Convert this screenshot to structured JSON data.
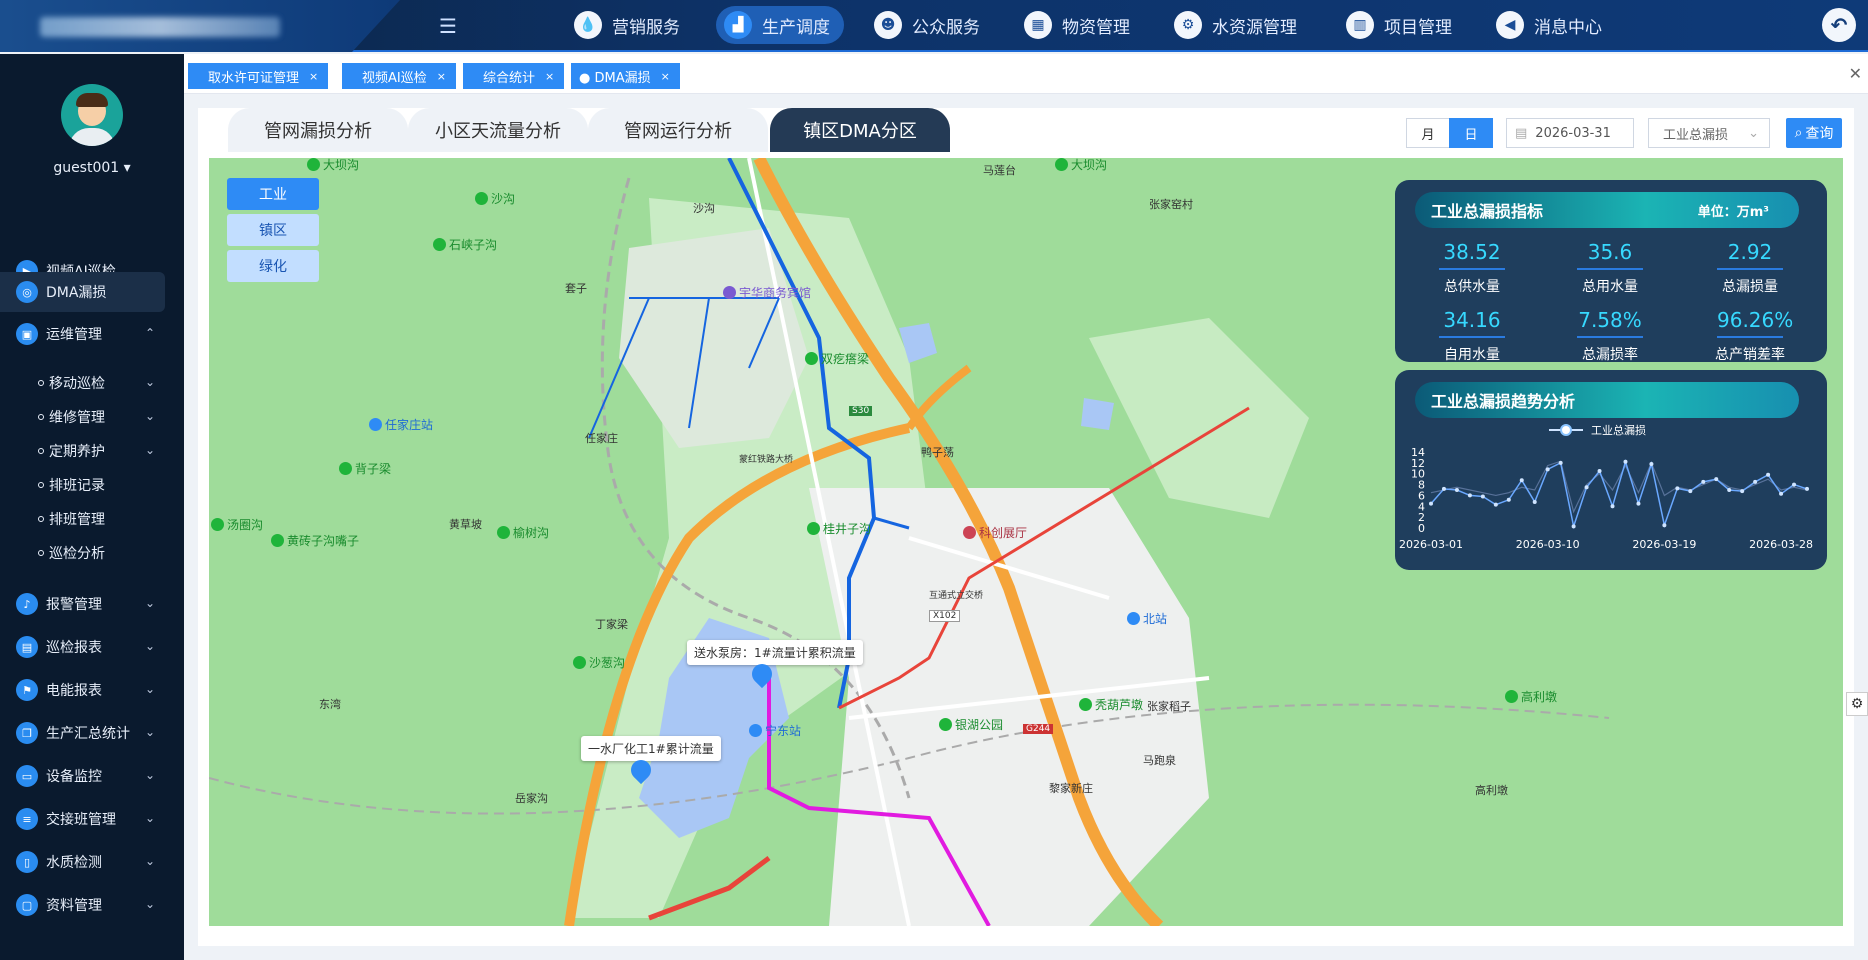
{
  "header": {
    "menu_icon": "menu-fold-icon",
    "nav": [
      {
        "label": "营销服务",
        "icon": "water-drop-icon",
        "active": false
      },
      {
        "label": "生产调度",
        "icon": "chart-icon",
        "active": true
      },
      {
        "label": "公众服务",
        "icon": "user-icon",
        "active": false
      },
      {
        "label": "物资管理",
        "icon": "boxes-icon",
        "active": false
      },
      {
        "label": "水资源管理",
        "icon": "water-settings-icon",
        "active": false
      },
      {
        "label": "项目管理",
        "icon": "building-icon",
        "active": false
      },
      {
        "label": "消息中心",
        "icon": "speaker-icon",
        "active": false
      }
    ]
  },
  "user": {
    "name": "guest001"
  },
  "sidebar": {
    "items": [
      {
        "label": "视频AI巡检"
      },
      {
        "label": "DMA漏损"
      },
      {
        "label": "运维管理"
      },
      {
        "label": "报警管理"
      },
      {
        "label": "巡检报表"
      },
      {
        "label": "电能报表"
      },
      {
        "label": "生产汇总统计"
      },
      {
        "label": "设备监控"
      },
      {
        "label": "交接班管理"
      },
      {
        "label": "水质检测"
      },
      {
        "label": "资料管理"
      }
    ],
    "subitems": [
      {
        "label": "移动巡检"
      },
      {
        "label": "维修管理"
      },
      {
        "label": "定期养护"
      },
      {
        "label": "排班记录"
      },
      {
        "label": "排班管理"
      },
      {
        "label": "巡检分析"
      }
    ]
  },
  "tabs": [
    {
      "label": "取水许可证管理"
    },
    {
      "label": "视频AI巡检"
    },
    {
      "label": "综合统计"
    },
    {
      "label": "● DMA漏损"
    }
  ],
  "subtabs": [
    {
      "label": "管网漏损分析"
    },
    {
      "label": "小区天流量分析"
    },
    {
      "label": "管网运行分析"
    },
    {
      "label": "镇区DMA分区"
    }
  ],
  "toolbar": {
    "month": "月",
    "day": "日",
    "date": "2026-03-31",
    "select": "工业总漏损",
    "query": "查询"
  },
  "filters": [
    {
      "label": "工业"
    },
    {
      "label": "镇区"
    },
    {
      "label": "绿化"
    }
  ],
  "map": {
    "labels": [
      "马莲台",
      "沙沟",
      "张家窑村",
      "套子",
      "任家庄",
      "鸭子荡",
      "黄草坡",
      "丁家梁",
      "东湾",
      "张家稻子",
      "马跑泉",
      "黎家新庄",
      "岳家沟",
      "高利墩",
      "蒙红铁路大桥",
      "互通式立交桥"
    ],
    "pois": [
      "大坝沟",
      "沙沟",
      "石峡子沟",
      "宇华商务宾馆",
      "双疙瘩梁",
      "任家庄站",
      "背子梁",
      "汤圈沟",
      "黄砖子沟嘴子",
      "榆树沟",
      "桂井子沟",
      "科创展厅",
      "北站",
      "沙葱沟",
      "宁东站",
      "银湖公园",
      "秃葫芦墩",
      "高利墩",
      "大坝沟"
    ],
    "tip1": "送水泵房：1#流量计累积流量",
    "tip2": "一水厂化工1#累计流量",
    "road_badges": [
      "S30",
      "X102",
      "G244"
    ]
  },
  "kpi_panel": {
    "title": "工业总漏损指标",
    "unit": "单位：万m³",
    "metrics": [
      {
        "value": "38.52",
        "label": "总供水量"
      },
      {
        "value": "35.6",
        "label": "总用水量"
      },
      {
        "value": "2.92",
        "label": "总漏损量"
      },
      {
        "value": "34.16",
        "label": "自用水量"
      },
      {
        "value": "7.58%",
        "label": "总漏损率"
      },
      {
        "value": "96.26%",
        "label": "总产销差率"
      }
    ]
  },
  "trend_panel": {
    "title": "工业总漏损趋势分析"
  },
  "chart_data": {
    "type": "line",
    "series": [
      {
        "name": "工业总漏损",
        "values": [
          4.5,
          7.2,
          7.0,
          6.0,
          5.8,
          4.3,
          5.2,
          8.8,
          4.8,
          10.8,
          12.0,
          0.3,
          7.5,
          10.5,
          4.0,
          12.2,
          4.5,
          11.8,
          0.5,
          7.3,
          6.8,
          8.5,
          9.0,
          7.0,
          6.8,
          8.5,
          9.8,
          6.3,
          8.0,
          7.2
        ]
      },
      {
        "name": "",
        "values": [
          6.5,
          7.0,
          7.5,
          7.0,
          6.5,
          6.0,
          6.5,
          7.5,
          7.0,
          11.5,
          12.3,
          3.0,
          8.0,
          10.0,
          7.0,
          11.5,
          6.5,
          12.0,
          6.0,
          7.5,
          7.0,
          8.0,
          9.0,
          7.5,
          7.0,
          8.0,
          9.0,
          7.0,
          7.5,
          7.0
        ]
      }
    ],
    "x_ticks": [
      "2026-03-01",
      "2026-03-10",
      "2026-03-19",
      "2026-03-28"
    ],
    "y_ticks": [
      "0",
      "2",
      "4",
      "6",
      "8",
      "10",
      "12",
      "14"
    ],
    "ylim": [
      0,
      14
    ],
    "legend": "top-center"
  }
}
